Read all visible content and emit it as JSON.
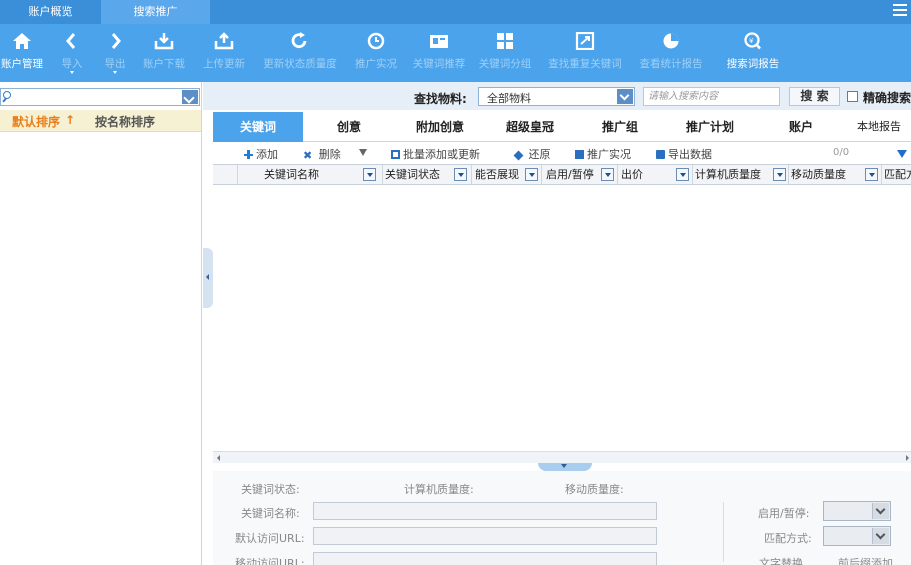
{
  "top_tabs": [
    {
      "label": "账户概览",
      "active": false
    },
    {
      "label": "搜索推广",
      "active": true
    }
  ],
  "toolbar": [
    {
      "label": "账户管理",
      "icon": "home-icon",
      "enabled": true
    },
    {
      "label": "导入",
      "icon": "import-icon",
      "enabled": false,
      "has_menu": true
    },
    {
      "label": "导出",
      "icon": "export-icon",
      "enabled": false,
      "has_menu": true
    },
    {
      "label": "账户下载",
      "icon": "download-icon",
      "enabled": false
    },
    {
      "label": "上传更新",
      "icon": "upload-icon",
      "enabled": false
    },
    {
      "label": "更新状态质量度",
      "icon": "refresh-icon",
      "enabled": false
    },
    {
      "label": "推广实况",
      "icon": "clock-icon",
      "enabled": false
    },
    {
      "label": "关键词推荐",
      "icon": "keyword-recommend-icon",
      "enabled": false
    },
    {
      "label": "关键词分组",
      "icon": "grid-icon",
      "enabled": false
    },
    {
      "label": "查找重复关键词",
      "icon": "duplicate-search-icon",
      "enabled": false
    },
    {
      "label": "查看统计报告",
      "icon": "pie-chart-icon",
      "enabled": false
    },
    {
      "label": "搜索词报告",
      "icon": "search-report-icon",
      "enabled": true
    }
  ],
  "left_panel": {
    "sort_default": "默认排序",
    "sort_name": "按名称排序"
  },
  "search": {
    "label": "查找物料:",
    "material": "全部物料",
    "placeholder": "请输入搜索内容",
    "button": "搜 索",
    "exact_label": "精确搜索"
  },
  "tabs": [
    "关键词",
    "创意",
    "附加创意",
    "超级皇冠",
    "推广组",
    "推广计划",
    "账户",
    "本地报告"
  ],
  "actions": {
    "add": "添加",
    "delete": "删除",
    "batch": "批量添加或更新",
    "restore": "还原",
    "live": "推广实况",
    "export": "导出数据",
    "count": "0/0"
  },
  "columns": [
    "关键词名称",
    "关键词状态",
    "能否展现",
    "启用/暂停",
    "出价",
    "计算机质量度",
    "移动质量度",
    "匹配方式"
  ],
  "detail": {
    "kw_status": "关键词状态:",
    "pc_quality": "计算机质量度:",
    "mobile_quality": "移动质量度:",
    "kw_name": "关键词名称:",
    "default_url": "默认访问URL:",
    "mobile_url": "移动访问URL:",
    "enable_pause": "启用/暂停:",
    "match_type": "匹配方式:",
    "text_replace": "文字替换",
    "prefix_suffix": "前后缀添加"
  },
  "colors": {
    "toolbar_bg": "#4ba3ec",
    "topbar_bg": "#3a8fd8",
    "sort_highlight": "#e87e1a"
  }
}
